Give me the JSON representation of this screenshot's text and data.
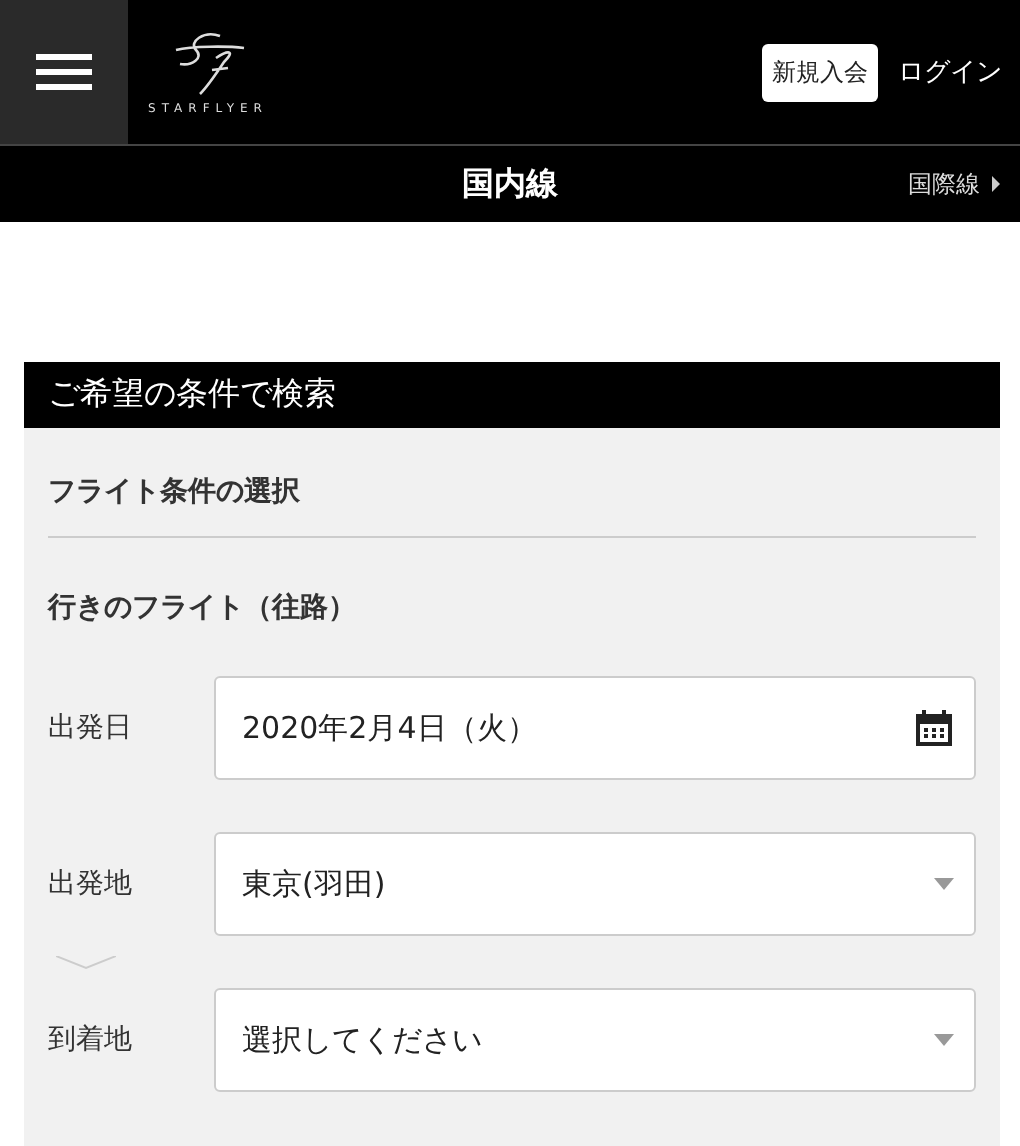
{
  "header": {
    "logo_text": "STARFLYER",
    "signup_button": "新規入会",
    "login_link": "ログイン"
  },
  "route_nav": {
    "current": "国内線",
    "other_link": "国際線"
  },
  "search_panel": {
    "title": "ご希望の条件で検索",
    "section_title": "フライト条件の選択",
    "leg_title": "行きのフライト（往路）",
    "fields": [
      {
        "kind": "date",
        "label": "出発日",
        "value": "2020年2月4日（火）"
      },
      {
        "kind": "select",
        "label": "出発地",
        "value": "東京(羽田)"
      },
      {
        "kind": "select",
        "label": "到着地",
        "value": "選択してください"
      }
    ]
  }
}
